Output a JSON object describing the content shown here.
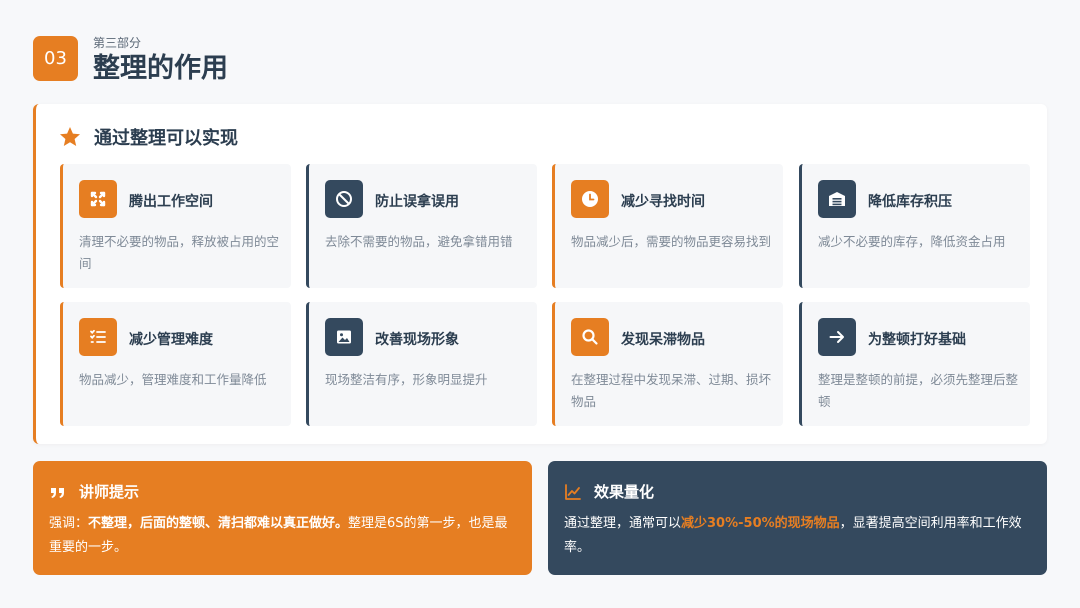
{
  "header": {
    "number": "03",
    "subtitle": "第三部分",
    "title": "整理的作用"
  },
  "main": {
    "title": "通过整理可以实现",
    "icon": "star-icon",
    "tiles": [
      {
        "title": "腾出工作空间",
        "desc": "清理不必要的物品，释放被占用的空间",
        "icon": "expand-icon",
        "accent": "orange"
      },
      {
        "title": "防止误拿误用",
        "desc": "去除不需要的物品，避免拿错用错",
        "icon": "ban-icon",
        "accent": "navy"
      },
      {
        "title": "减少寻找时间",
        "desc": "物品减少后，需要的物品更容易找到",
        "icon": "clock-icon",
        "accent": "orange"
      },
      {
        "title": "降低库存积压",
        "desc": "减少不必要的库存，降低资金占用",
        "icon": "warehouse-icon",
        "accent": "navy"
      },
      {
        "title": "减少管理难度",
        "desc": "物品减少，管理难度和工作量降低",
        "icon": "tasks-icon",
        "accent": "orange"
      },
      {
        "title": "改善现场形象",
        "desc": "现场整洁有序，形象明显提升",
        "icon": "image-icon",
        "accent": "navy"
      },
      {
        "title": "发现呆滞物品",
        "desc": "在整理过程中发现呆滞、过期、损坏物品",
        "icon": "search-icon",
        "accent": "orange"
      },
      {
        "title": "为整顿打好基础",
        "desc": "整理是整顿的前提，必须先整理后整顿",
        "icon": "arrow-right-icon",
        "accent": "navy"
      }
    ]
  },
  "tips": {
    "title": "讲师提示",
    "icon": "quote-icon",
    "prefix": "强调：",
    "bold": "不整理，后面的整顿、清扫都难以真正做好。",
    "suffix": "整理是6S的第一步，也是最重要的一步。"
  },
  "effect": {
    "title": "效果量化",
    "icon": "chart-line-icon",
    "prefix": "通过整理，通常可以",
    "highlight": "减少30%-50%的现场物品",
    "suffix": "，显著提高空间利用率和工作效率。"
  },
  "colors": {
    "accent": "#e67e22",
    "navy": "#34495e",
    "background": "#f7f8fa"
  }
}
